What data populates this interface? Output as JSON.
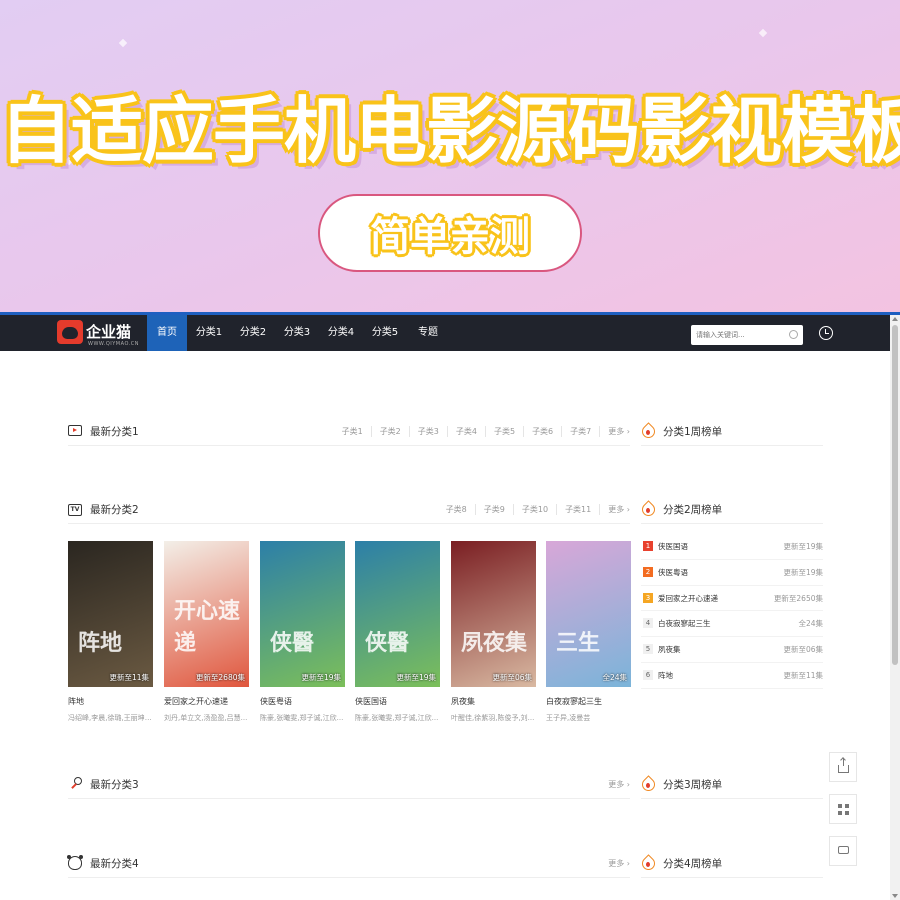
{
  "banner": {
    "title": "自适应手机电影源码影视模板",
    "pill": "简单亲测"
  },
  "logo": {
    "name": "企业猫",
    "sub": "WWW.QIYMAO.CN"
  },
  "nav": {
    "items": [
      "首页",
      "分类1",
      "分类2",
      "分类3",
      "分类4",
      "分类5",
      "专题"
    ],
    "active": 0,
    "search_placeholder": "请输入关键词..."
  },
  "sections": [
    {
      "title": "最新分类1",
      "icon": "screen-icon",
      "links": [
        "子类1",
        "子类2",
        "子类3",
        "子类4",
        "子类5",
        "子类6",
        "子类7"
      ],
      "more": "更多 ›"
    },
    {
      "title": "最新分类2",
      "icon": "tv-icon",
      "icon_text": "TV",
      "links": [
        "子类8",
        "子类9",
        "子类10",
        "子类11"
      ],
      "more": "更多 ›"
    },
    {
      "title": "最新分类3",
      "icon": "mic-icon",
      "links": [],
      "more": "更多 ›"
    },
    {
      "title": "最新分类4",
      "icon": "bear-icon",
      "links": [],
      "more": "更多 ›"
    }
  ],
  "rank_titles": [
    "分类1周榜单",
    "分类2周榜单",
    "分类3周榜单",
    "分类4周榜单"
  ],
  "posters": [
    {
      "title": "阵地",
      "actors": "冯绍峰,李晨,徐璐,王丽坤,...",
      "ep": "更新至11集",
      "art": "阵地",
      "color1": "#2a2620",
      "color2": "#6b5a42"
    },
    {
      "title": "爱回家之开心速递",
      "actors": "刘丹,单立文,汤盈盈,吕慧...",
      "ep": "更新至2680集",
      "art": "开心速递",
      "color1": "#f3efe8",
      "color2": "#e0563d"
    },
    {
      "title": "侠医粤语",
      "actors": "陈豪,张曦雯,郑子诚,江欣...",
      "ep": "更新至19集",
      "art": "侠醫",
      "color1": "#2c7fa8",
      "color2": "#7cbf5a"
    },
    {
      "title": "侠医国语",
      "actors": "陈豪,张曦雯,郑子诚,江欣...",
      "ep": "更新至19集",
      "art": "侠醫",
      "color1": "#2c7fa8",
      "color2": "#7cbf5a"
    },
    {
      "title": "夙夜集",
      "actors": "叶醒佳,徐紫羽,陈俊予,刘...",
      "ep": "更新至06集",
      "art": "夙夜集",
      "color1": "#7a1e22",
      "color2": "#d9b9a2"
    },
    {
      "title": "白夜寂寥起三生",
      "actors": "王子异,凌曼芸",
      "ep": "全24集",
      "art": "三生",
      "color1": "#d8a7d8",
      "color2": "#7bb4d9"
    }
  ],
  "rank2": [
    {
      "no": "1",
      "name": "侠医国语",
      "status": "更新至19集"
    },
    {
      "no": "2",
      "name": "侠医粤语",
      "status": "更新至19集"
    },
    {
      "no": "3",
      "name": "爱回家之开心速递",
      "status": "更新至2650集"
    },
    {
      "no": "4",
      "name": "白夜寂寥起三生",
      "status": "全24集"
    },
    {
      "no": "5",
      "name": "夙夜集",
      "status": "更新至06集"
    },
    {
      "no": "6",
      "name": "阵地",
      "status": "更新至11集"
    }
  ],
  "tools": [
    "share-icon",
    "qrcode-icon",
    "chat-icon"
  ],
  "colors": {
    "nav_bg": "#20232c",
    "nav_active": "#1e63b8",
    "accent": "#f9c31a",
    "rank1": "#e8412e",
    "rank2": "#f36c21",
    "rank3": "#f5a623"
  }
}
